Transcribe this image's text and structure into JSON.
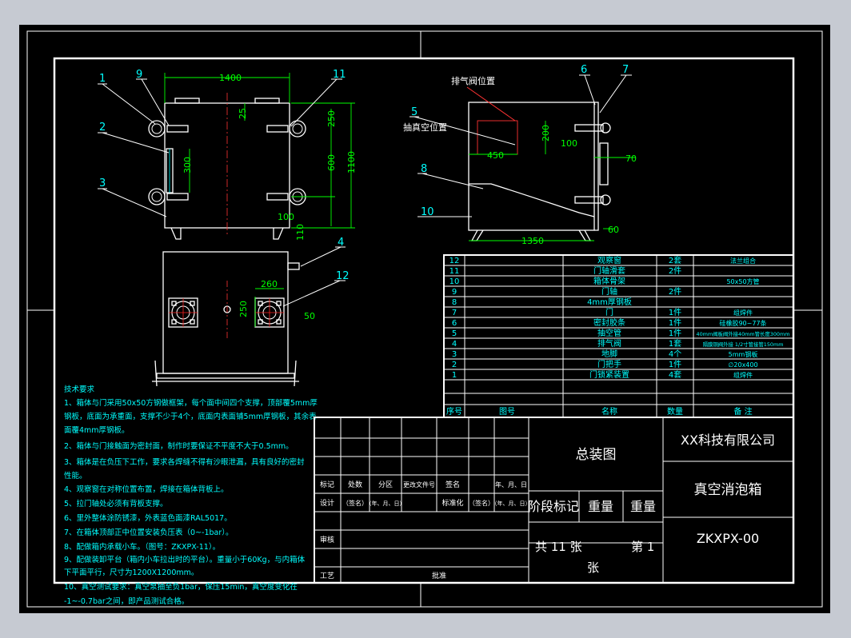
{
  "drawing": {
    "callouts": {
      "c1": "1",
      "c2": "2",
      "c3": "3",
      "c4": "4",
      "c5": "5",
      "c6": "6",
      "c7": "7",
      "c8": "8",
      "c9": "9",
      "c10": "10",
      "c11": "11",
      "c12": "12"
    },
    "notes": {
      "exhaust_valve_position": "排气阀位置",
      "vacuum_port_position": "抽真空位置"
    },
    "dimensions": {
      "d1400": "1400",
      "d25": "25",
      "d250a": "250",
      "d300": "300",
      "d600": "600",
      "d1100": "1100",
      "d100a": "100",
      "d110": "110",
      "d200": "200",
      "d450": "450",
      "d100b": "100",
      "d70": "70",
      "d60": "60",
      "d1350": "1350",
      "d260": "260",
      "d250b": "250",
      "d50": "50"
    }
  },
  "tech_requirements": {
    "title": "技术要求",
    "lines": [
      "1、箱体与门采用50x50方钢做框架，每个面中间四个支撑，顶部覆5mm厚",
      "钢板，底面为承重面，支撑不少于4个，底面内表面铺5mm厚钢板，其余表",
      "面覆4mm厚钢板。",
      "2、箱体与门接触面为密封面，制作时要保证不平度不大于0.5mm。",
      "3、箱体是在负压下工作，要求各焊缝不得有沙眼泄漏，具有良好的密封",
      "性能。",
      "4、观察窗在对称位置布置，焊接在箱体背板上。",
      "5、拉门轴处必须有背板支撑。",
      "6、里外整体涂防锈漆，外表蓝色面漆RAL5017。",
      "7、在箱体顶部正中位置安装负压表（0~-1bar）。",
      "8、配做箱内承载小车。（图号：ZKXPX-11）。",
      "9、配做装卸平台（箱内小车拉出时的平台）。重量小于60Kg，与内箱体",
      "下平面平行，尺寸为1200X1200mm。",
      "10、真空测试要求：真空泵抽至负1bar，保压15min，真空度变化在",
      "-1~-0.7bar之间，即产品测试合格。"
    ]
  },
  "parts_list": {
    "headers": {
      "seq": "序号",
      "drawing_no": "图号",
      "name": "名称",
      "qty": "数量",
      "remark": "备 注"
    },
    "rows": [
      {
        "seq": "12",
        "name": "观察窗",
        "qty": "2套",
        "remark": "法兰组合"
      },
      {
        "seq": "11",
        "name": "门轴滑套",
        "qty": "2件",
        "remark": ""
      },
      {
        "seq": "10",
        "name": "箱体骨架",
        "qty": "",
        "remark": "50x50方管"
      },
      {
        "seq": "9",
        "name": "门轴",
        "qty": "2件",
        "remark": ""
      },
      {
        "seq": "8",
        "name": "4mm厚钢板",
        "qty": "",
        "remark": ""
      },
      {
        "seq": "7",
        "name": "门",
        "qty": "1件",
        "remark": "组焊件"
      },
      {
        "seq": "6",
        "name": "密封胶条",
        "qty": "1件",
        "remark": "硅橡胶90~77条"
      },
      {
        "seq": "5",
        "name": "抽空管",
        "qty": "1件",
        "remark": "40mm阀板阀外接40mm管长度300mm"
      },
      {
        "seq": "4",
        "name": "排气阀",
        "qty": "1套",
        "remark": "隔膜铜阀外接 1/2寸管接管150mm"
      },
      {
        "seq": "3",
        "name": "地脚",
        "qty": "4个",
        "remark": "5mm钢板"
      },
      {
        "seq": "2",
        "name": "门把手",
        "qty": "1件",
        "remark": "∅20x400"
      },
      {
        "seq": "1",
        "name": "门锁紧装置",
        "qty": "4套",
        "remark": "组焊件"
      }
    ]
  },
  "title_block": {
    "company": "XX科技有限公司",
    "drawing_title": "总装图",
    "product_name": "真空消泡箱",
    "drawing_number": "ZKXPX-00",
    "stage_mark": "阶段标记",
    "weight1": "重量",
    "weight2": "重量",
    "total_sheets": "共 11 张",
    "sheet": "第 1",
    "sheet_unit": "张",
    "rev_labels": {
      "mark": "标记",
      "count": "处数",
      "zone": "分区",
      "doc_no": "更改文件号",
      "signature": "签名",
      "date": "年、月、日"
    },
    "sign_labels": {
      "design": "设计",
      "sign1": "（签名）",
      "date1": "（年、月、日）",
      "standard": "标准化",
      "sign2": "（签名）",
      "date2": "（年、月、日）",
      "check": "审核",
      "process": "工艺",
      "approve": "批准"
    }
  }
}
